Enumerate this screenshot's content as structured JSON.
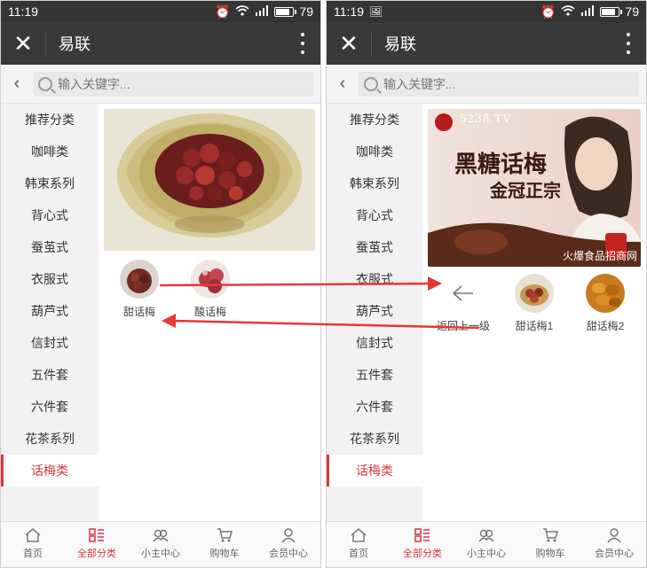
{
  "status": {
    "time": "11:19",
    "battery": "79"
  },
  "header": {
    "title": "易联"
  },
  "search": {
    "placeholder": "输入关键字..."
  },
  "sidebar": {
    "items": [
      "推荐分类",
      "咖啡类",
      "韩束系列",
      "背心式",
      "蚕茧式",
      "衣服式",
      "葫芦式",
      "信封式",
      "五件套",
      "六件套",
      "花茶系列",
      "话梅类"
    ],
    "active_index": 11
  },
  "left_panel": {
    "subcategories": [
      {
        "label": "甜话梅",
        "icon": "dark-plum-image"
      },
      {
        "label": "酸话梅",
        "icon": "red-plum-image"
      }
    ]
  },
  "right_panel": {
    "banner": {
      "text_main": "黑糖话梅",
      "text_sub": "金冠正宗",
      "watermark": "5238.TV",
      "footer": "火爆食品招商网"
    },
    "back_label": "返回上一级",
    "subcategories": [
      {
        "label": "甜话梅1",
        "icon": "plum-bowl-image"
      },
      {
        "label": "甜话梅2",
        "icon": "dried-plum-image"
      }
    ]
  },
  "tabbar": {
    "tabs": [
      {
        "label": "首页",
        "icon": "home-icon"
      },
      {
        "label": "全部分类",
        "icon": "category-icon"
      },
      {
        "label": "小主中心",
        "icon": "users-icon"
      },
      {
        "label": "购物车",
        "icon": "cart-icon"
      },
      {
        "label": "会员中心",
        "icon": "member-icon"
      }
    ],
    "active_index": 1
  },
  "colors": {
    "accent": "#d9363e",
    "header": "#393939",
    "statusbar": "#343434",
    "arrow": "#e53935"
  }
}
